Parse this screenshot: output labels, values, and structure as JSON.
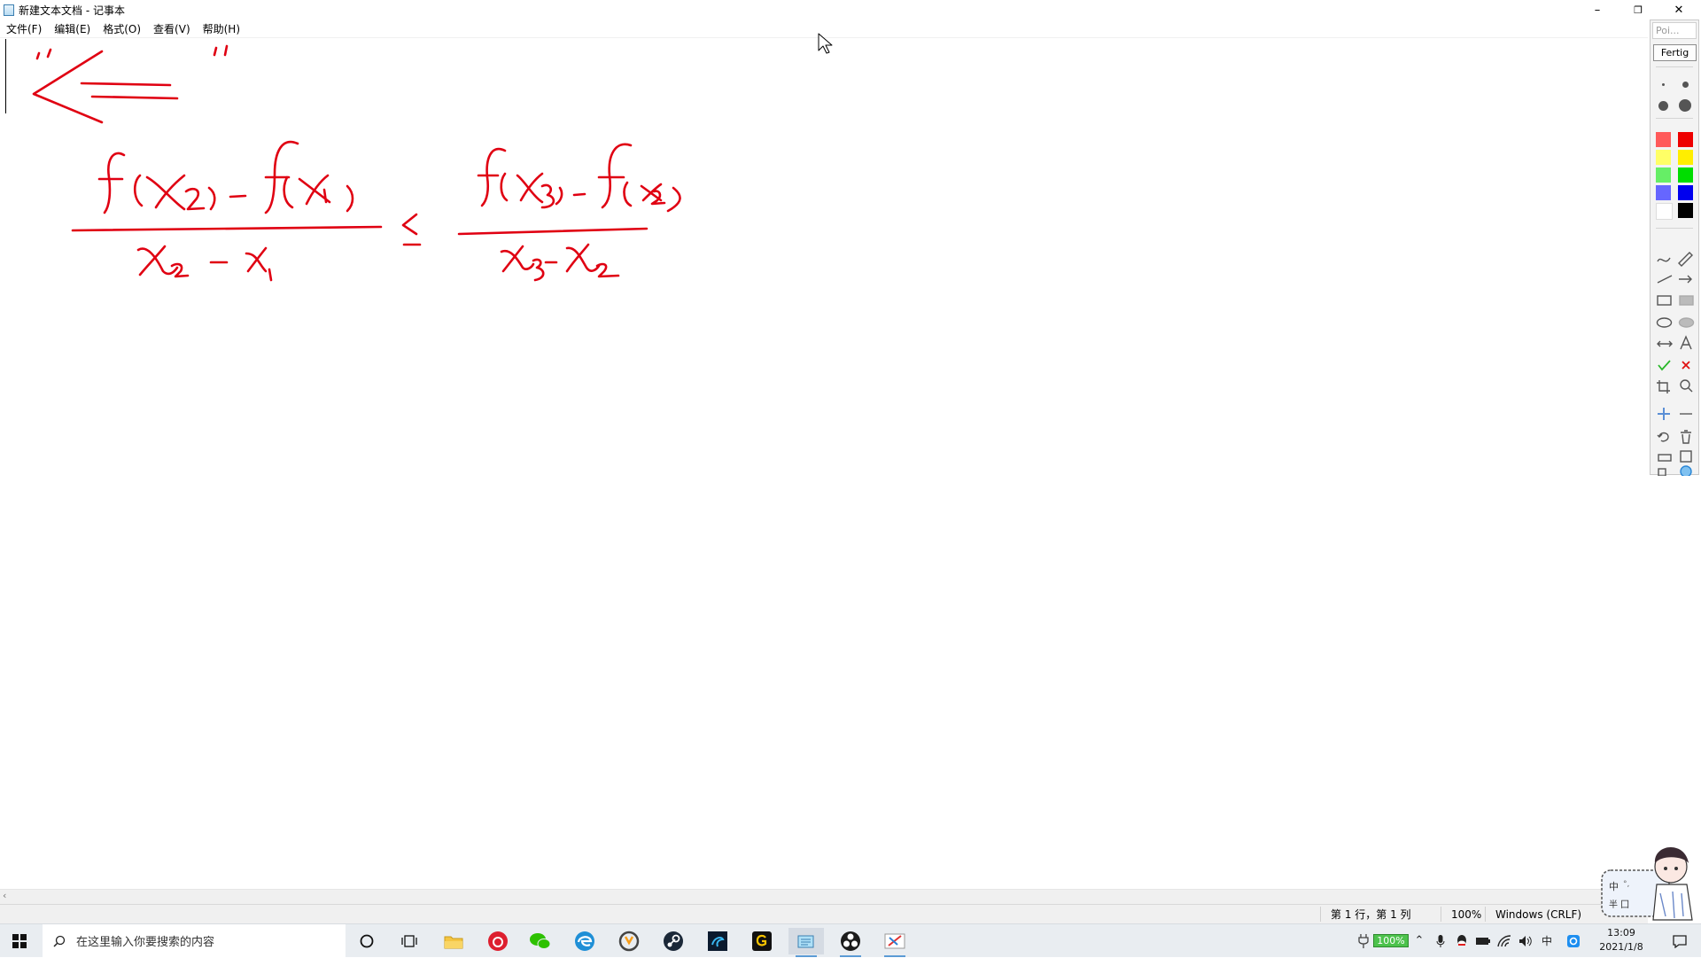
{
  "window": {
    "title": "新建文本文档 - 记事本",
    "minimize_glyph": "–",
    "restore_glyph": "❐",
    "close_glyph": "✕"
  },
  "menu": [
    "文件(F)",
    "编辑(E)",
    "格式(O)",
    "查看(V)",
    "帮助(H)"
  ],
  "ink_color": "#e00012",
  "status": {
    "position": "第 1 行，第 1 列",
    "zoom": "100%",
    "line_ending": "Windows (CRLF)"
  },
  "pen_toolbar": {
    "search_placeholder": "Poi...",
    "done_label": "Fertig",
    "colors": [
      "#ff5a5a",
      "#ee0000",
      "#ffff66",
      "#ffee00",
      "#66ee66",
      "#00dd00",
      "#6666ff",
      "#0000ee",
      "#ffffff",
      "#000000"
    ]
  },
  "taskbar": {
    "search_placeholder": "在这里输入你要搜索的内容",
    "battery_label": "100%",
    "ime_label": "中",
    "time": "13:09",
    "date": "2021/1/8"
  },
  "mascot": {
    "ime_char": "中",
    "punct": "°,",
    "row2": "半 囗"
  }
}
